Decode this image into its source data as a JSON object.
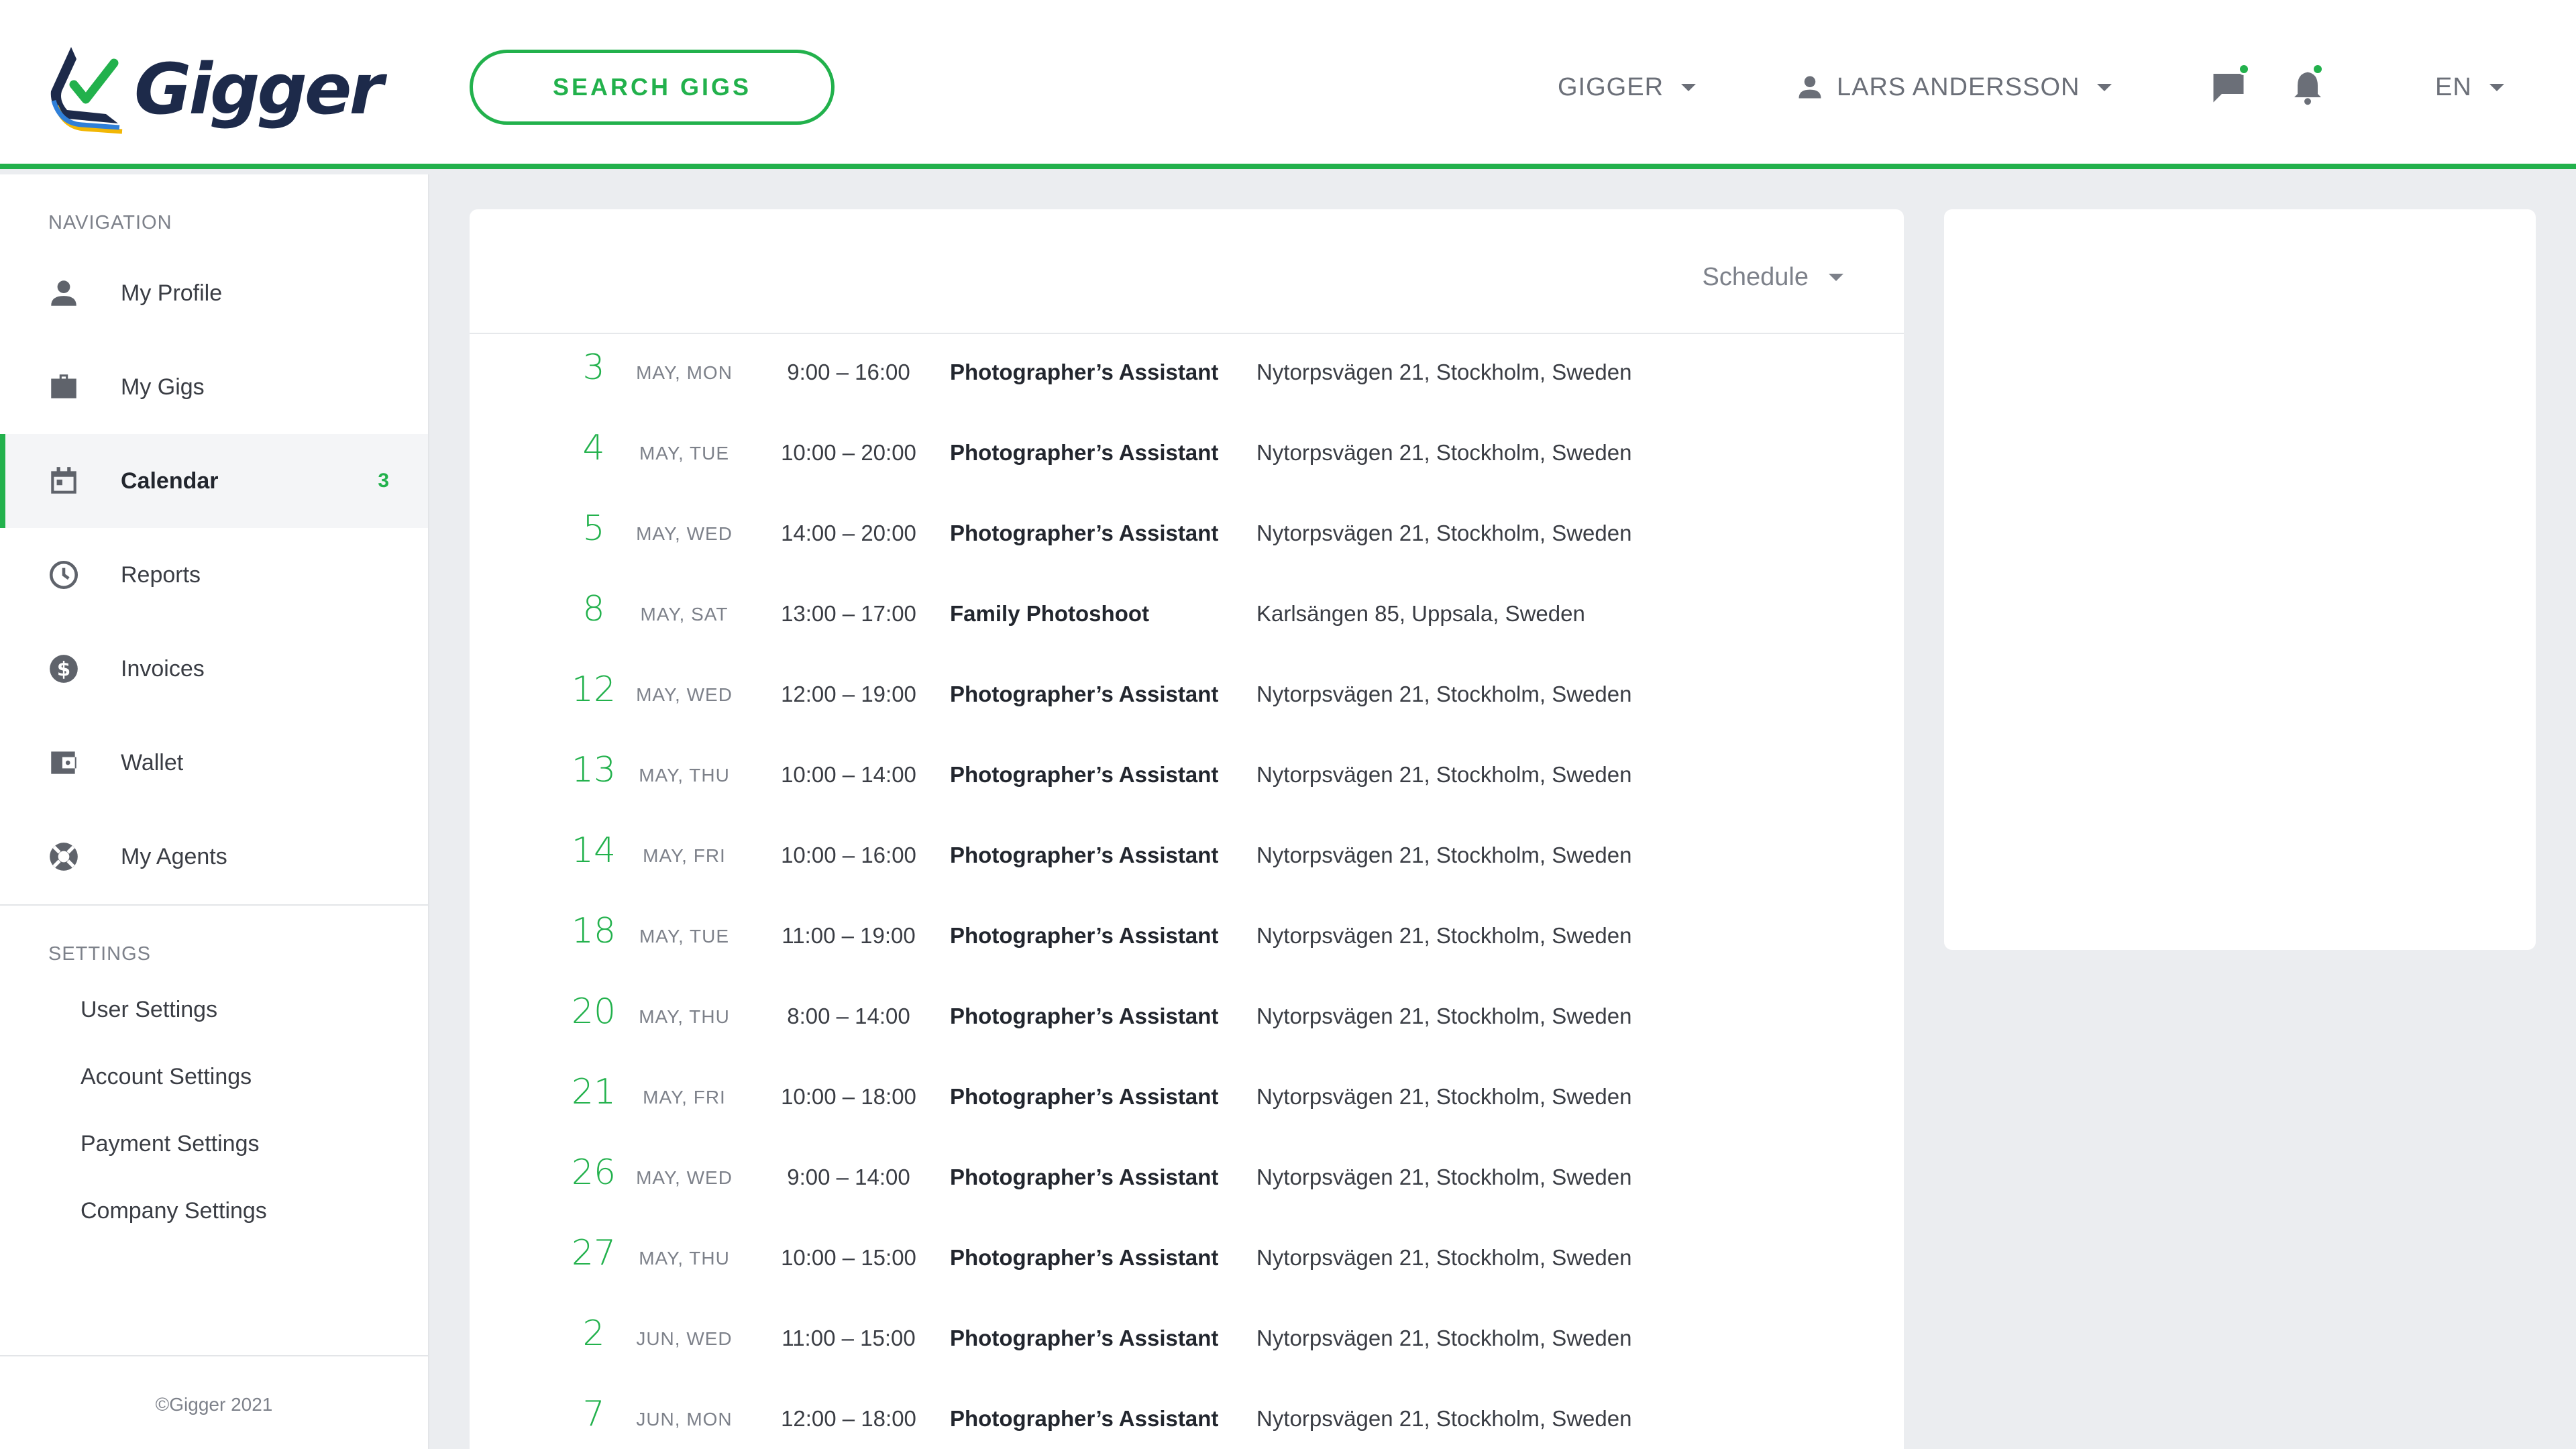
{
  "app": {
    "name": "Gigger"
  },
  "header": {
    "search_label": "SEARCH GIGS",
    "org_label": "GIGGER",
    "user_label": "LARS ANDERSSON",
    "lang_label": "EN",
    "accent_color": "#22b14c"
  },
  "sidebar": {
    "nav_title": "NAVIGATION",
    "items": [
      {
        "label": "My Profile",
        "icon": "person-icon"
      },
      {
        "label": "My Gigs",
        "icon": "briefcase-icon"
      },
      {
        "label": "Calendar",
        "icon": "calendar-icon",
        "badge": "3",
        "active": true
      },
      {
        "label": "Reports",
        "icon": "clock-icon"
      },
      {
        "label": "Invoices",
        "icon": "dollar-icon"
      },
      {
        "label": "Wallet",
        "icon": "wallet-icon"
      },
      {
        "label": "My Agents",
        "icon": "lifebuoy-icon"
      }
    ],
    "settings_title": "SETTINGS",
    "settings": [
      "User Settings",
      "Account Settings",
      "Payment Settings",
      "Company Settings"
    ],
    "copyright": "©Gigger 2021"
  },
  "calendar": {
    "view_label": "Schedule",
    "events": [
      {
        "day": "3",
        "month_weekday": "MAY, MON",
        "time": "9:00 – 16:00",
        "title": "Photographer’s Assistant",
        "address": "Nytorpsvägen 21, Stockholm, Sweden"
      },
      {
        "day": "4",
        "month_weekday": "MAY, TUE",
        "time": "10:00 – 20:00",
        "title": "Photographer’s Assistant",
        "address": "Nytorpsvägen 21, Stockholm, Sweden"
      },
      {
        "day": "5",
        "month_weekday": "MAY, WED",
        "time": "14:00 – 20:00",
        "title": "Photographer’s Assistant",
        "address": "Nytorpsvägen 21, Stockholm, Sweden"
      },
      {
        "day": "8",
        "month_weekday": "MAY, SAT",
        "time": "13:00 – 17:00",
        "title": "Family Photoshoot",
        "address": "Karlsängen 85, Uppsala, Sweden"
      },
      {
        "day": "12",
        "month_weekday": "MAY, WED",
        "time": "12:00 – 19:00",
        "title": "Photographer’s Assistant",
        "address": "Nytorpsvägen 21, Stockholm, Sweden"
      },
      {
        "day": "13",
        "month_weekday": "MAY, THU",
        "time": "10:00 – 14:00",
        "title": "Photographer’s Assistant",
        "address": "Nytorpsvägen 21, Stockholm, Sweden"
      },
      {
        "day": "14",
        "month_weekday": "MAY, FRI",
        "time": "10:00 – 16:00",
        "title": "Photographer’s Assistant",
        "address": "Nytorpsvägen 21, Stockholm, Sweden"
      },
      {
        "day": "18",
        "month_weekday": "MAY, TUE",
        "time": "11:00 – 19:00",
        "title": "Photographer’s Assistant",
        "address": "Nytorpsvägen 21, Stockholm, Sweden"
      },
      {
        "day": "20",
        "month_weekday": "MAY, THU",
        "time": "8:00 – 14:00",
        "title": "Photographer’s Assistant",
        "address": "Nytorpsvägen 21, Stockholm, Sweden"
      },
      {
        "day": "21",
        "month_weekday": "MAY, FRI",
        "time": "10:00 – 18:00",
        "title": "Photographer’s Assistant",
        "address": "Nytorpsvägen 21, Stockholm, Sweden"
      },
      {
        "day": "26",
        "month_weekday": "MAY, WED",
        "time": "9:00 – 14:00",
        "title": "Photographer’s Assistant",
        "address": "Nytorpsvägen 21, Stockholm, Sweden"
      },
      {
        "day": "27",
        "month_weekday": "MAY, THU",
        "time": "10:00 – 15:00",
        "title": "Photographer’s Assistant",
        "address": "Nytorpsvägen 21, Stockholm, Sweden"
      },
      {
        "day": "2",
        "month_weekday": "JUN, WED",
        "time": "11:00 – 15:00",
        "title": "Photographer’s Assistant",
        "address": "Nytorpsvägen 21, Stockholm, Sweden"
      },
      {
        "day": "7",
        "month_weekday": "JUN, MON",
        "time": "12:00 – 18:00",
        "title": "Photographer’s Assistant",
        "address": "Nytorpsvägen 21, Stockholm, Sweden"
      }
    ]
  }
}
